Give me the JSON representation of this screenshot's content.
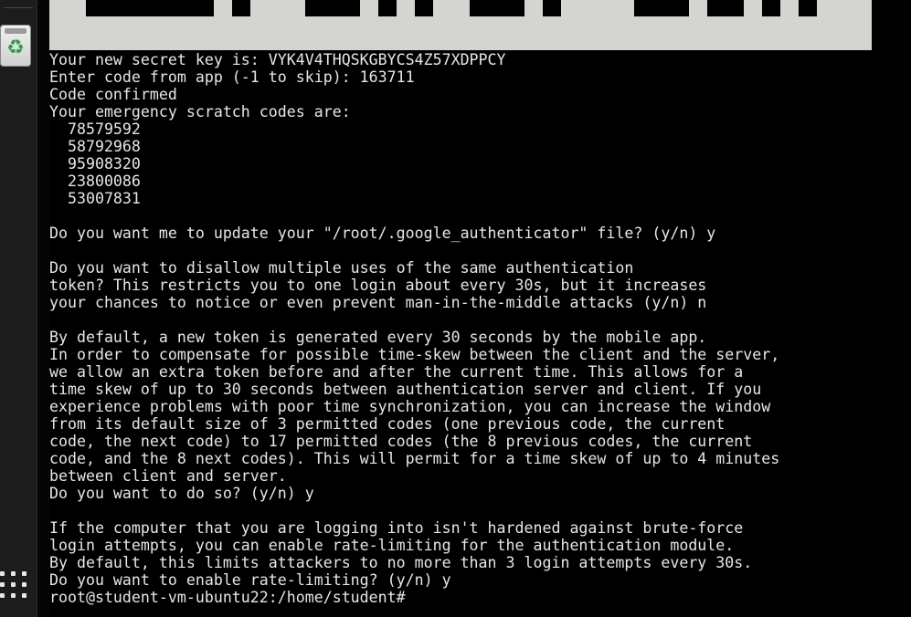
{
  "terminal": {
    "lines": [
      "Your new secret key is: VYK4V4THQSKGBYCS4Z57XDPPCY",
      "Enter code from app (-1 to skip): 163711",
      "Code confirmed",
      "Your emergency scratch codes are:",
      "  78579592",
      "  58792968",
      "  95908320",
      "  23800086",
      "  53007831",
      "",
      "Do you want me to update your \"/root/.google_authenticator\" file? (y/n) y",
      "",
      "Do you want to disallow multiple uses of the same authentication",
      "token? This restricts you to one login about every 30s, but it increases",
      "your chances to notice or even prevent man-in-the-middle attacks (y/n) n",
      "",
      "By default, a new token is generated every 30 seconds by the mobile app.",
      "In order to compensate for possible time-skew between the client and the server,",
      "we allow an extra token before and after the current time. This allows for a",
      "time skew of up to 30 seconds between authentication server and client. If you",
      "experience problems with poor time synchronization, you can increase the window",
      "from its default size of 3 permitted codes (one previous code, the current",
      "code, the next code) to 17 permitted codes (the 8 previous codes, the current",
      "code, and the 8 next codes). This will permit for a time skew of up to 4 minutes",
      "between client and server.",
      "Do you want to do so? (y/n) y",
      "",
      "If the computer that you are logging into isn't hardened against brute-force",
      "login attempts, you can enable rate-limiting for the authentication module.",
      "By default, this limits attackers to no more than 3 login attempts every 30s.",
      "Do you want to enable rate-limiting? (y/n) y"
    ],
    "prompt": "root@student-vm-ubuntu22:/home/student#"
  },
  "dock": {
    "trash_icon": "trash-icon",
    "apps_icon": "show-applications-icon"
  },
  "colors": {
    "terminal_bg": "#000000",
    "terminal_fg": "#e6e6e6",
    "qr_bg": "#d4d4d0",
    "dock_bg": "#1c1c1c",
    "wallpaper_accent": "#961414"
  }
}
